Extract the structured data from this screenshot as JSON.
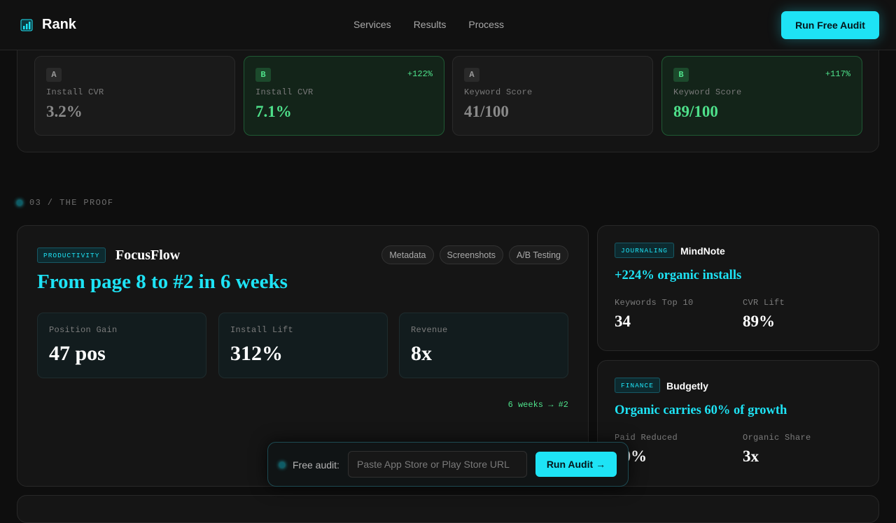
{
  "header": {
    "brand": "Rank",
    "nav": [
      "Services",
      "Results",
      "Process"
    ],
    "cta": "Run Free Audit"
  },
  "ab_tests": [
    {
      "variant": "A",
      "label": "Install CVR",
      "value": "3.2%",
      "delta": ""
    },
    {
      "variant": "B",
      "label": "Install CVR",
      "value": "7.1%",
      "delta": "+122%"
    },
    {
      "variant": "A",
      "label": "Keyword Score",
      "value": "41/100",
      "delta": ""
    },
    {
      "variant": "B",
      "label": "Keyword Score",
      "value": "89/100",
      "delta": "+117%"
    }
  ],
  "section": {
    "label": "03 / THE PROOF"
  },
  "case_main": {
    "tag": "PRODUCTIVITY",
    "name": "FocusFlow",
    "pills": [
      "Metadata",
      "Screenshots",
      "A/B Testing"
    ],
    "headline": "From page 8 to #2 in 6 weeks",
    "metrics": [
      {
        "label": "Position Gain",
        "value": "47 pos"
      },
      {
        "label": "Install Lift",
        "value": "312%"
      },
      {
        "label": "Revenue",
        "value": "8x"
      }
    ],
    "note": "6 weeks → #2"
  },
  "case_side": [
    {
      "tag": "JOURNALING",
      "name": "MindNote",
      "headline": "+224% organic installs",
      "stats": [
        {
          "label": "Keywords Top 10",
          "value": "34"
        },
        {
          "label": "CVR Lift",
          "value": "89%"
        }
      ]
    },
    {
      "tag": "FINANCE",
      "name": "Budgetly",
      "headline": "Organic carries 60% of growth",
      "stats": [
        {
          "label": "Paid Reduced",
          "value": "40%"
        },
        {
          "label": "Organic Share",
          "value": "3x"
        }
      ]
    }
  ],
  "audit_bar": {
    "label": "Free audit:",
    "placeholder": "Paste App Store or Play Store URL",
    "button": "Run Audit",
    "button_arrow": "→"
  },
  "colors": {
    "accent": "#1ee3f5",
    "success": "#4ee08a",
    "background": "#0e0e0e"
  }
}
